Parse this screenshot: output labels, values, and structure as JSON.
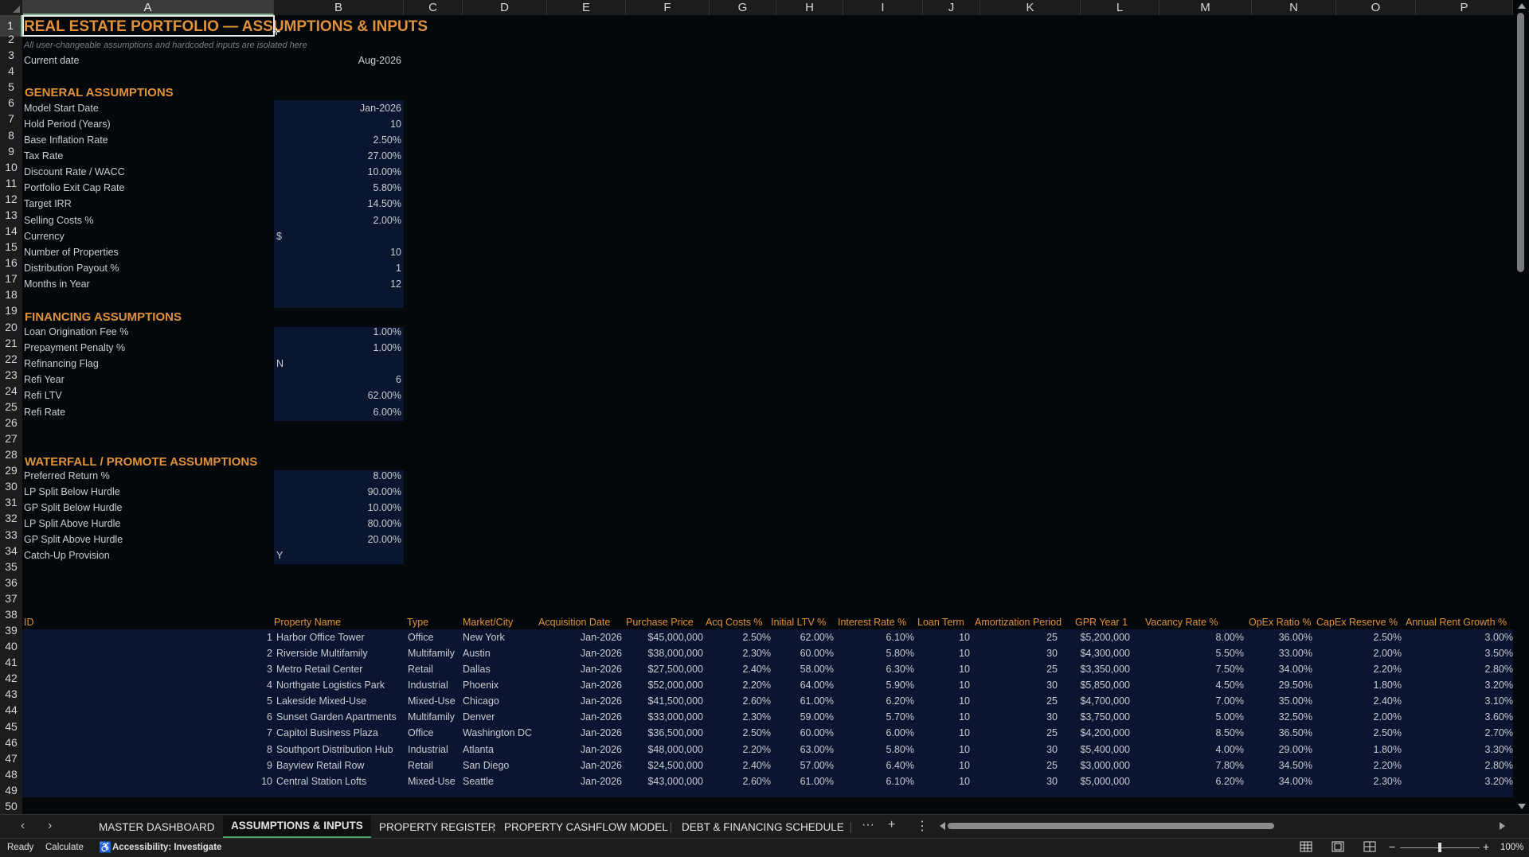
{
  "colors": {
    "accent": "#e0913a",
    "input_bg": "#0a1530",
    "bg": "#05080b",
    "selection": "#7fae8e"
  },
  "columns": [
    "A",
    "B",
    "C",
    "D",
    "E",
    "F",
    "G",
    "H",
    "I",
    "J",
    "K",
    "L",
    "M",
    "N",
    "O",
    "P"
  ],
  "rows": [
    "1",
    "2",
    "3",
    "4",
    "5",
    "6",
    "7",
    "8",
    "9",
    "10",
    "11",
    "12",
    "13",
    "14",
    "15",
    "16",
    "17",
    "18",
    "19",
    "20",
    "21",
    "22",
    "23",
    "24",
    "25",
    "26",
    "27",
    "28",
    "29",
    "30",
    "31",
    "32",
    "33",
    "34",
    "35",
    "36",
    "37",
    "38",
    "39",
    "40",
    "41",
    "42",
    "43",
    "44",
    "45",
    "46",
    "47",
    "48",
    "49",
    "50"
  ],
  "sheet": {
    "title": "REAL ESTATE PORTFOLIO — ASSUMPTIONS & INPUTS",
    "subtitle": "All user-changeable assumptions and hardcoded inputs are isolated here",
    "current_date_label": "Current date",
    "current_date_value": "Aug-2026",
    "general_header": "GENERAL ASSUMPTIONS",
    "general": [
      {
        "label": "Model Start Date",
        "value": "Jan-2026",
        "align": "right"
      },
      {
        "label": "Hold Period (Years)",
        "value": "10",
        "align": "right"
      },
      {
        "label": "Base Inflation Rate",
        "value": "2.50%",
        "align": "right"
      },
      {
        "label": "Tax Rate",
        "value": "27.00%",
        "align": "right"
      },
      {
        "label": "Discount Rate / WACC",
        "value": "10.00%",
        "align": "right"
      },
      {
        "label": "Portfolio Exit Cap Rate",
        "value": "5.80%",
        "align": "right"
      },
      {
        "label": "Target IRR",
        "value": "14.50%",
        "align": "right"
      },
      {
        "label": "Selling Costs %",
        "value": "2.00%",
        "align": "right"
      },
      {
        "label": "Currency",
        "value": "$",
        "align": "left"
      },
      {
        "label": "Number of Properties",
        "value": "10",
        "align": "right"
      },
      {
        "label": "Distribution Payout %",
        "value": "1",
        "align": "right"
      },
      {
        "label": "Months in Year",
        "value": "12",
        "align": "right"
      }
    ],
    "financing_header": "FINANCING ASSUMPTIONS",
    "financing": [
      {
        "label": "Loan Origination Fee %",
        "value": "1.00%",
        "align": "right"
      },
      {
        "label": "Prepayment Penalty %",
        "value": "1.00%",
        "align": "right"
      },
      {
        "label": "Refinancing Flag",
        "value": "N",
        "align": "left"
      },
      {
        "label": "Refi Year",
        "value": "6",
        "align": "right"
      },
      {
        "label": "Refi LTV",
        "value": "62.00%",
        "align": "right"
      },
      {
        "label": "Refi Rate",
        "value": "6.00%",
        "align": "right"
      }
    ],
    "waterfall_header": "WATERFALL / PROMOTE ASSUMPTIONS",
    "waterfall": [
      {
        "label": "Preferred Return %",
        "value": "8.00%",
        "align": "right"
      },
      {
        "label": "LP Split Below Hurdle",
        "value": "90.00%",
        "align": "right"
      },
      {
        "label": "GP Split Below Hurdle",
        "value": "10.00%",
        "align": "right"
      },
      {
        "label": "LP Split Above Hurdle",
        "value": "80.00%",
        "align": "right"
      },
      {
        "label": "GP Split Above Hurdle",
        "value": "20.00%",
        "align": "right"
      },
      {
        "label": "Catch-Up Provision",
        "value": "Y",
        "align": "left"
      }
    ],
    "register_headers": [
      "ID",
      "Property Name",
      "Type",
      "Market/City",
      "Acquisition Date",
      "Purchase Price",
      "Acq Costs %",
      "Initial LTV %",
      "Interest Rate %",
      "Loan Term",
      "Amortization Period",
      "GPR Year 1",
      "Vacancy Rate %",
      "OpEx Ratio %",
      "CapEx Reserve %",
      "Annual Rent Growth %"
    ],
    "register_rows": [
      [
        "1",
        "Harbor Office Tower",
        "Office",
        "New York",
        "Jan-2026",
        "$45,000,000",
        "2.50%",
        "62.00%",
        "6.10%",
        "10",
        "25",
        "$5,200,000",
        "8.00%",
        "36.00%",
        "2.50%",
        "3.00%"
      ],
      [
        "2",
        "Riverside Multifamily",
        "Multifamily",
        "Austin",
        "Jan-2026",
        "$38,000,000",
        "2.30%",
        "60.00%",
        "5.80%",
        "10",
        "30",
        "$4,300,000",
        "5.50%",
        "33.00%",
        "2.00%",
        "3.50%"
      ],
      [
        "3",
        "Metro Retail Center",
        "Retail",
        "Dallas",
        "Jan-2026",
        "$27,500,000",
        "2.40%",
        "58.00%",
        "6.30%",
        "10",
        "25",
        "$3,350,000",
        "7.50%",
        "34.00%",
        "2.20%",
        "2.80%"
      ],
      [
        "4",
        "Northgate Logistics Park",
        "Industrial",
        "Phoenix",
        "Jan-2026",
        "$52,000,000",
        "2.20%",
        "64.00%",
        "5.90%",
        "10",
        "30",
        "$5,850,000",
        "4.50%",
        "29.50%",
        "1.80%",
        "3.20%"
      ],
      [
        "5",
        "Lakeside Mixed-Use",
        "Mixed-Use",
        "Chicago",
        "Jan-2026",
        "$41,500,000",
        "2.60%",
        "61.00%",
        "6.20%",
        "10",
        "25",
        "$4,700,000",
        "7.00%",
        "35.00%",
        "2.40%",
        "3.10%"
      ],
      [
        "6",
        "Sunset Garden Apartments",
        "Multifamily",
        "Denver",
        "Jan-2026",
        "$33,000,000",
        "2.30%",
        "59.00%",
        "5.70%",
        "10",
        "30",
        "$3,750,000",
        "5.00%",
        "32.50%",
        "2.00%",
        "3.60%"
      ],
      [
        "7",
        "Capitol Business Plaza",
        "Office",
        "Washington DC",
        "Jan-2026",
        "$36,500,000",
        "2.50%",
        "60.00%",
        "6.00%",
        "10",
        "25",
        "$4,200,000",
        "8.50%",
        "36.50%",
        "2.50%",
        "2.70%"
      ],
      [
        "8",
        "Southport Distribution Hub",
        "Industrial",
        "Atlanta",
        "Jan-2026",
        "$48,000,000",
        "2.20%",
        "63.00%",
        "5.80%",
        "10",
        "30",
        "$5,400,000",
        "4.00%",
        "29.00%",
        "1.80%",
        "3.30%"
      ],
      [
        "9",
        "Bayview Retail Row",
        "Retail",
        "San Diego",
        "Jan-2026",
        "$24,500,000",
        "2.40%",
        "57.00%",
        "6.40%",
        "10",
        "25",
        "$3,000,000",
        "7.80%",
        "34.50%",
        "2.20%",
        "2.80%"
      ],
      [
        "10",
        "Central Station Lofts",
        "Mixed-Use",
        "Seattle",
        "Jan-2026",
        "$43,000,000",
        "2.60%",
        "61.00%",
        "6.10%",
        "10",
        "30",
        "$5,000,000",
        "6.20%",
        "34.00%",
        "2.30%",
        "3.20%"
      ]
    ]
  },
  "tabs": {
    "items": [
      "MASTER DASHBOARD",
      "ASSUMPTIONS & INPUTS",
      "PROPERTY REGISTER",
      "PROPERTY CASHFLOW MODEL",
      "DEBT & FINANCING SCHEDULE"
    ],
    "active_index": 1,
    "more_glyph": "···",
    "add_glyph": "+",
    "options_glyph": "⋮"
  },
  "status": {
    "ready": "Ready",
    "calculate": "Calculate",
    "accessibility": "Accessibility: Investigate",
    "zoom": "100%"
  },
  "icons": [
    "scroll-left-icon",
    "scroll-right-icon",
    "accessibility-icon",
    "normal-view-icon",
    "page-layout-icon",
    "page-break-icon",
    "zoom-out-icon",
    "zoom-in-icon"
  ]
}
